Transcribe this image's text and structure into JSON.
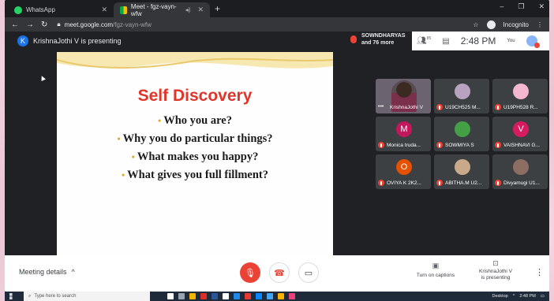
{
  "browser": {
    "tabs": [
      {
        "label": "WhatsApp",
        "icon": "whatsapp-icon"
      },
      {
        "label": "Meet - fgz-vayn-wfw",
        "icon": "meet-icon"
      }
    ],
    "url_host": "meet.google.com",
    "url_path": "/fgz-vayn-wfw",
    "incognito_label": "Incognito"
  },
  "meet": {
    "presenter_initial": "K",
    "presenter_text": "KrishnaJothi V is presenting",
    "viewers_line1": "SOWNDHARYAS",
    "viewers_line2": "and 76 more",
    "people_count": "85",
    "time": "2:48 PM",
    "you_label": "You"
  },
  "slide": {
    "title": "Self Discovery",
    "bullets": [
      "Who you are?",
      "Why you do particular things?",
      "What makes you happy?",
      "What gives you full fillment?"
    ]
  },
  "participants": [
    {
      "name": "KrishnaJothi V",
      "initial": "",
      "color": "#6b6470"
    },
    {
      "name": "U19CH525 M...",
      "initial": "",
      "color": "#b9a1c0"
    },
    {
      "name": "U19PH528 R...",
      "initial": "",
      "color": "#f3b7cf"
    },
    {
      "name": "Monica truda...",
      "initial": "M",
      "color": "#c2185b"
    },
    {
      "name": "SOWMIYA S",
      "initial": "",
      "color": "#43a047"
    },
    {
      "name": "VAISHNAVI G...",
      "initial": "V",
      "color": "#d81b60"
    },
    {
      "name": "OVIYA K 2K2...",
      "initial": "O",
      "color": "#e65100"
    },
    {
      "name": "ABITHA.M U2...",
      "initial": "",
      "color": "#c8a98a"
    },
    {
      "name": "Divyamugi U1...",
      "initial": "",
      "color": "#8d6e63"
    }
  ],
  "bottom": {
    "meeting_details": "Meeting details",
    "captions": "Turn on captions",
    "presenting_line1": "KrishnaJothi V",
    "presenting_line2": "is presenting"
  },
  "taskbar": {
    "search_placeholder": "Type here to search",
    "desktop_label": "Desktop",
    "clock_time": "2:48 PM"
  }
}
